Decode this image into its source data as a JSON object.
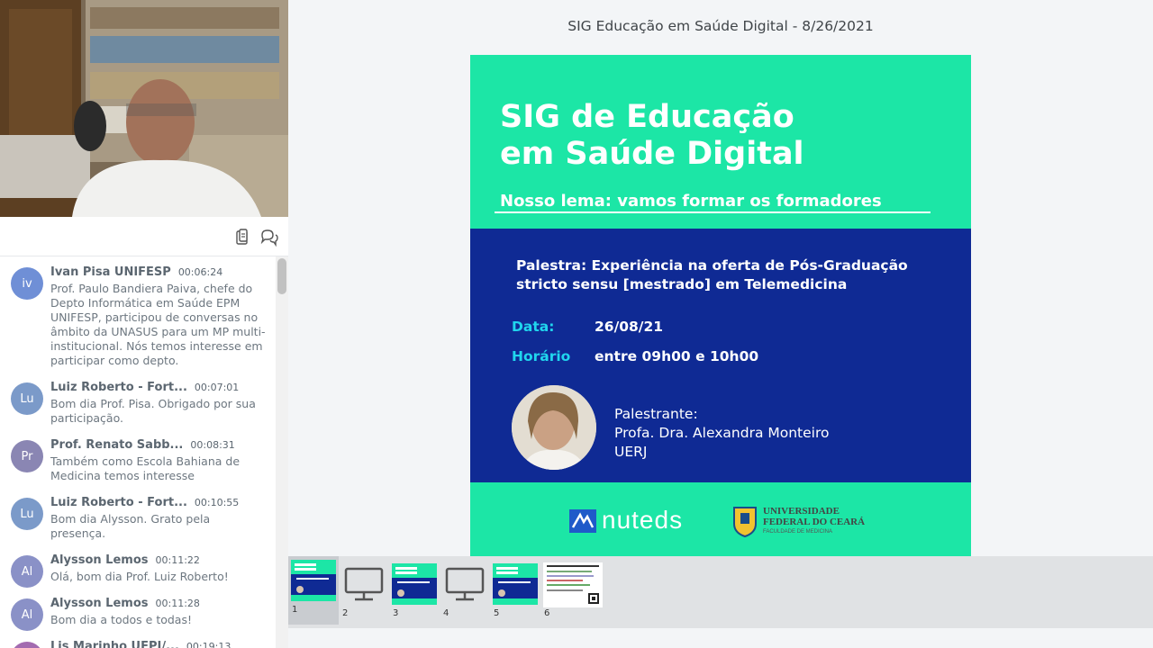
{
  "presentation": {
    "title": "SIG Educação em Saúde Digital - 8/26/2021"
  },
  "chat": {
    "toolbar": {
      "copy_icon": "clipboard-icon",
      "chat_icon": "chat-bubbles-icon"
    },
    "messages": [
      {
        "initials": "iv",
        "color": "#6f8fd6",
        "name": "Ivan Pisa UNIFESP",
        "time": "00:06:24",
        "text": "Prof. Paulo Bandiera Paiva, chefe do Depto Informática em Saúde EPM UNIFESP, participou de conversas no âmbito da UNASUS para um MP multi-institucional. Nós temos interesse em participar como depto."
      },
      {
        "initials": "Lu",
        "color": "#7b9ac9",
        "name": "Luiz Roberto - Fort...",
        "time": "00:07:01",
        "text": "Bom dia Prof. Pisa. Obrigado por sua participação."
      },
      {
        "initials": "Pr",
        "color": "#8a86b3",
        "name": "Prof. Renato Sabb...",
        "time": "00:08:31",
        "text": "Também como Escola Bahiana de Medicina temos interesse"
      },
      {
        "initials": "Lu",
        "color": "#7b9ac9",
        "name": "Luiz Roberto - Fort...",
        "time": "00:10:55",
        "text": "Bom dia Alysson. Grato pela presença."
      },
      {
        "initials": "Al",
        "color": "#8a91c7",
        "name": "Alysson Lemos",
        "time": "00:11:22",
        "text": "Olá, bom dia Prof. Luiz Roberto!"
      },
      {
        "initials": "Al",
        "color": "#8a91c7",
        "name": "Alysson Lemos",
        "time": "00:11:28",
        "text": "Bom dia a todos e todas!"
      },
      {
        "initials": "Li",
        "color": "#a36bb0",
        "name": "Lis Marinho UFPI/...",
        "time": "00:19:13",
        "text": ""
      }
    ]
  },
  "slide": {
    "title_line1": "SIG de Educação",
    "title_line2": "em Saúde Digital",
    "lema": "Nosso lema: vamos formar os formadores",
    "palestra_line1": "Palestra: Experiência na oferta de Pós-Graduação",
    "palestra_line2": "stricto sensu [mestrado] em Telemedicina",
    "data_label": "Data:",
    "data_value": "26/08/21",
    "horario_label": "Horário",
    "horario_value": "entre 09h00 e 10h00",
    "speaker_label": "Palestrante:",
    "speaker_name": "Profa. Dra. Alexandra Monteiro",
    "speaker_inst": "UERJ",
    "logo_nuteds": "nuteds",
    "logo_ufc_line1": "UNIVERSIDADE",
    "logo_ufc_line2": "FEDERAL DO CEARÁ",
    "logo_ufc_line3": "FACULDADE DE MEDICINA"
  },
  "thumbnails": [
    {
      "num": "1",
      "kind": "slide",
      "active": true
    },
    {
      "num": "2",
      "kind": "screen",
      "active": false
    },
    {
      "num": "3",
      "kind": "slide",
      "active": false
    },
    {
      "num": "4",
      "kind": "screen",
      "active": false
    },
    {
      "num": "5",
      "kind": "slide",
      "active": false
    },
    {
      "num": "6",
      "kind": "doc",
      "active": false
    }
  ]
}
